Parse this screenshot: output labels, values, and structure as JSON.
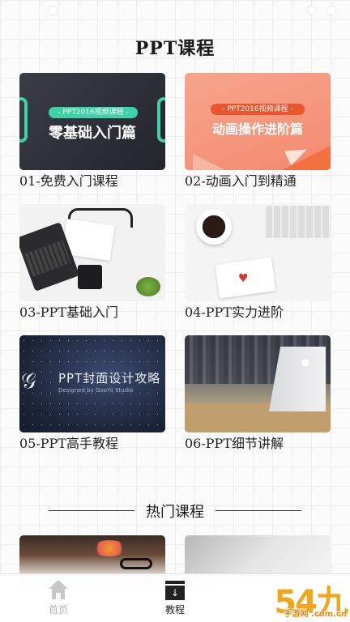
{
  "page_title": "PPT课程",
  "courses": [
    {
      "label": "01-免费入门课程",
      "thumb_tag": "- PPT2016视频课程 -",
      "thumb_title": "零基础入门篇"
    },
    {
      "label": "02-动画入门到精通",
      "thumb_tag": "- PPT2016视频课程 -",
      "thumb_title": "动画操作进阶篇"
    },
    {
      "label": "03-PPT基础入门"
    },
    {
      "label": "04-PPT实力进阶"
    },
    {
      "label": "05-PPT高手教程",
      "thumb_title": "PPT封面设计攻略",
      "thumb_sub": "Designed by GooYii Studio"
    },
    {
      "label": "06-PPT细节讲解"
    }
  ],
  "hot_section": {
    "title": "热门课程"
  },
  "tabbar": {
    "home_label": "首页",
    "course_label": "教程"
  },
  "watermark": {
    "big": "54九",
    "small": "手游网 .com.cn"
  },
  "colors": {
    "accent_green": "#3ed3a6",
    "accent_orange": "#e8552f",
    "watermark": "#f2a51a"
  }
}
